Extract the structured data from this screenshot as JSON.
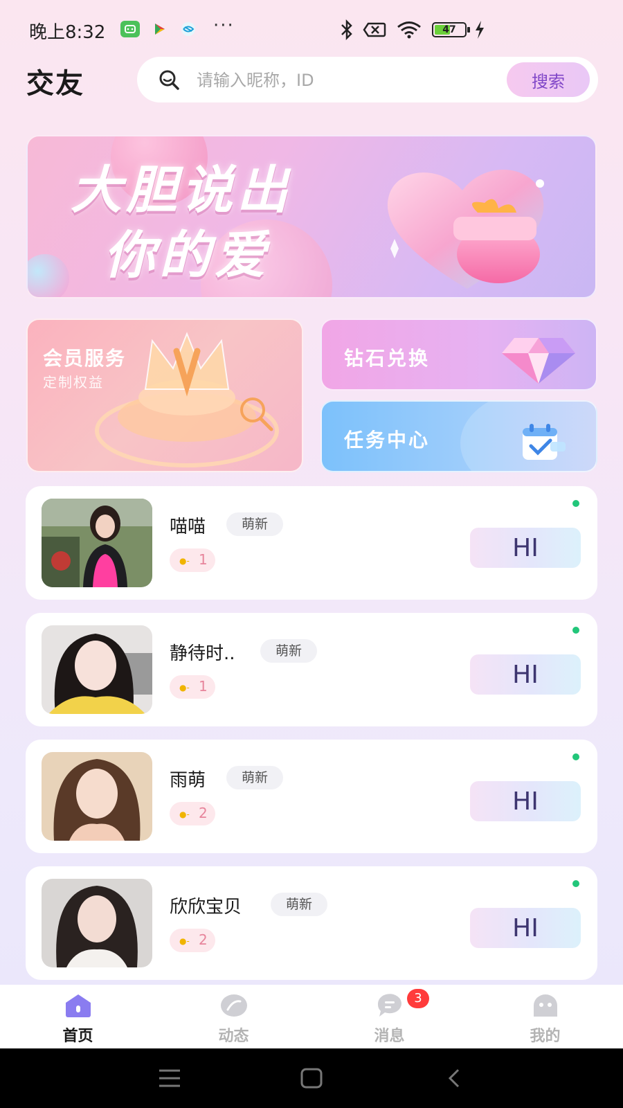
{
  "status_bar": {
    "time": "晚上8:32",
    "dots": "···",
    "battery": "47"
  },
  "header": {
    "title": "交友",
    "search": {
      "placeholder": "请输入昵称，ID",
      "value": "",
      "button_label": "搜索"
    }
  },
  "banner": {
    "line1": "大胆说出",
    "line2": "你的爱"
  },
  "features": {
    "vip": {
      "title": "会员服务",
      "subtitle": "定制权益"
    },
    "diamond": {
      "title": "钻石兑换"
    },
    "task": {
      "title": "任务中心"
    }
  },
  "users": [
    {
      "name": "喵喵",
      "tag": "萌新",
      "level": "1",
      "hi_label": "HI"
    },
    {
      "name": "静待时..",
      "tag": "萌新",
      "level": "1",
      "hi_label": "HI"
    },
    {
      "name": "雨萌",
      "tag": "萌新",
      "level": "2",
      "hi_label": "HI"
    },
    {
      "name": "欣欣宝贝",
      "tag": "萌新",
      "level": "2",
      "hi_label": "HI"
    }
  ],
  "tab_bar": {
    "tabs": [
      {
        "label": "首页",
        "icon": "home-icon",
        "active": true
      },
      {
        "label": "动态",
        "icon": "feed-icon",
        "active": false
      },
      {
        "label": "消息",
        "icon": "message-icon",
        "active": false
      },
      {
        "label": "我的",
        "icon": "profile-icon",
        "active": false
      }
    ],
    "message_badge": "3"
  },
  "colors": {
    "accent": "#8046c8",
    "online": "#22c67a",
    "badge": "#ff3b3b",
    "level_text": "#e7849b"
  }
}
